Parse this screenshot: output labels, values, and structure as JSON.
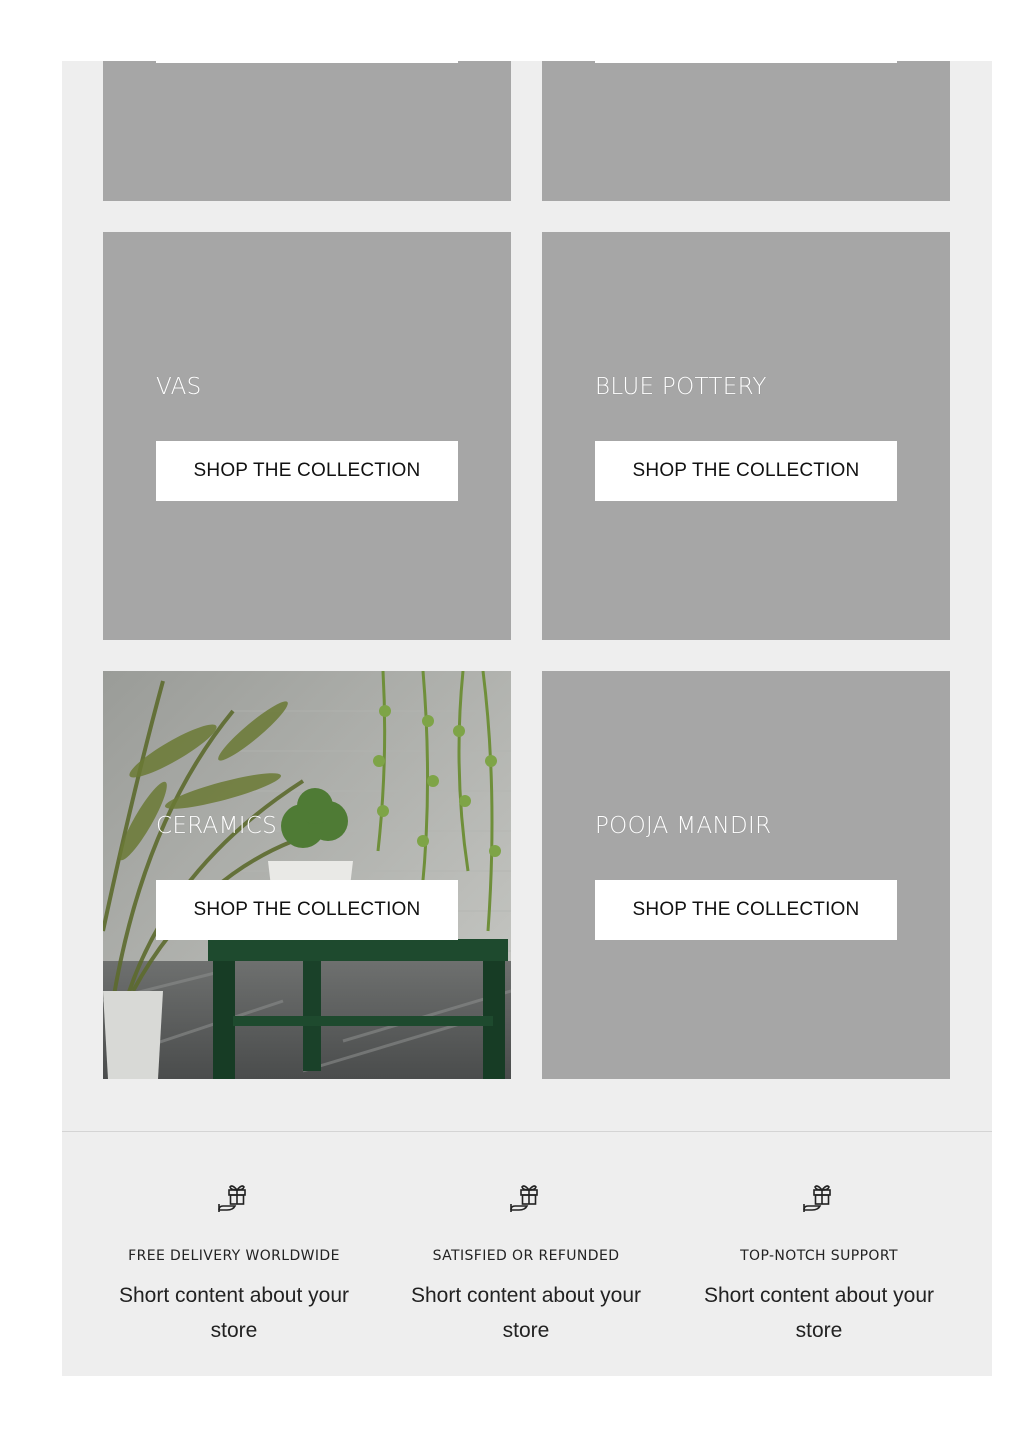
{
  "collections": [
    {
      "title": "",
      "button": ""
    },
    {
      "title": "",
      "button": ""
    },
    {
      "title": "VAS",
      "button": "SHOP THE COLLECTION"
    },
    {
      "title": "BLUE POTTERY",
      "button": "SHOP THE COLLECTION"
    },
    {
      "title": "CERAMICS",
      "button": "SHOP THE COLLECTION",
      "image": "plants-green-table-photo"
    },
    {
      "title": "POOJA MANDIR",
      "button": "SHOP THE COLLECTION"
    }
  ],
  "features": [
    {
      "icon": "gift-hand-icon",
      "title": "FREE DELIVERY WORLDWIDE",
      "body": "Short content about your store"
    },
    {
      "icon": "gift-hand-icon",
      "title": "SATISFIED OR REFUNDED",
      "body": "Short content about your store"
    },
    {
      "icon": "gift-hand-icon",
      "title": "TOP-NOTCH SUPPORT",
      "body": "Short content about your store"
    }
  ],
  "colors": {
    "page_background": "#eeeeee",
    "tile_placeholder": "#a6a6a6",
    "button_background": "#ffffff",
    "table_green": "#1e4a2e"
  }
}
